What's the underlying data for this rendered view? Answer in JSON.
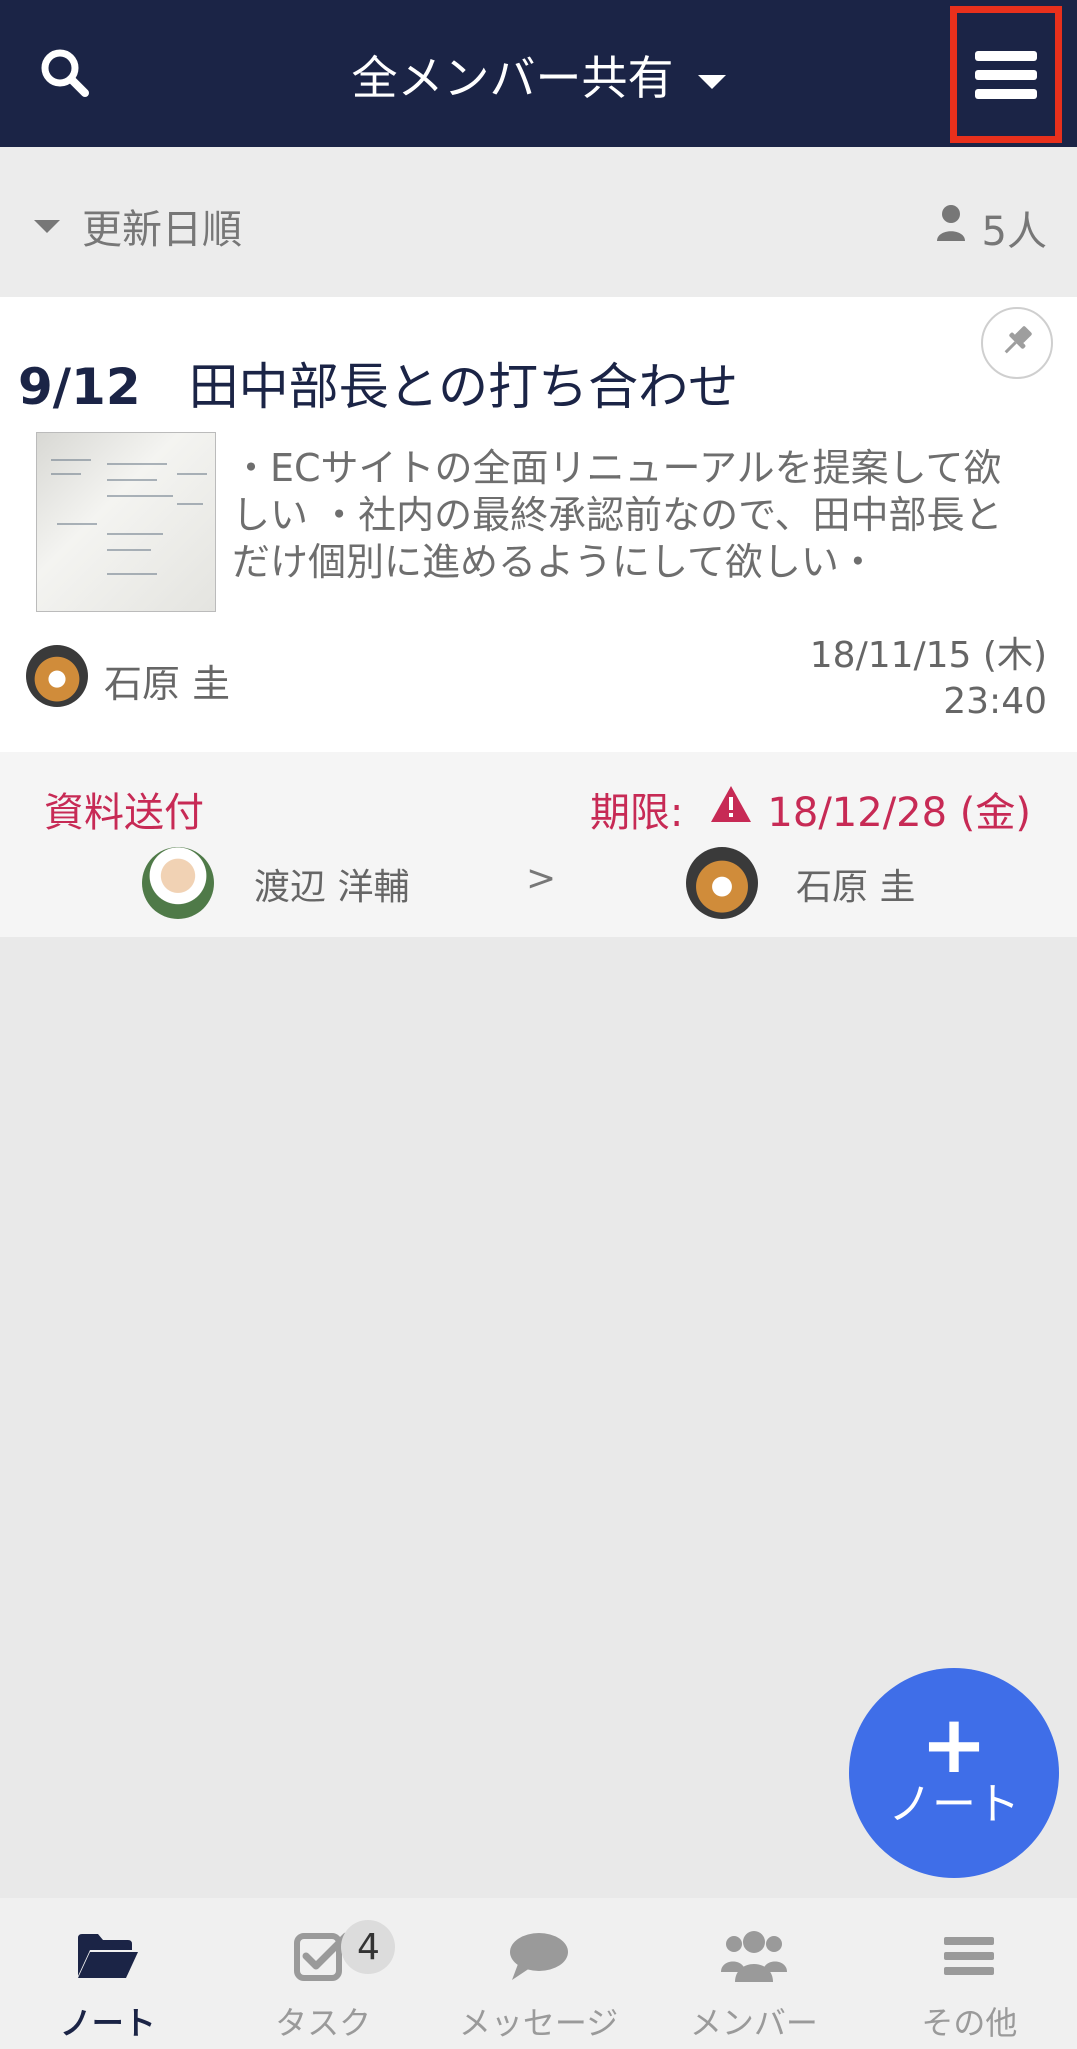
{
  "header": {
    "title": "全メンバー共有",
    "search_icon": "search-icon",
    "menu_icon": "hamburger-menu-icon",
    "highlight_color": "#e8301c",
    "bg_color": "#1b2446"
  },
  "sort": {
    "label": "更新日順",
    "members": "5人"
  },
  "note": {
    "date": "9/12",
    "title": "田中部長との打ち合わせ",
    "preview": "・ECサイトの全面リニューアルを提案して欲しい ・社内の最終承認前なので、田中部長とだけ個別に進めるようにして欲しい・",
    "author": "石原 圭",
    "updated_date": "18/11/15 (木)",
    "updated_time": "23:40",
    "pin_icon": "pin-icon"
  },
  "task": {
    "title": "資料送付",
    "deadline_label": "期限:",
    "deadline_date": "18/12/28 (金)",
    "from": "渡辺 洋輔",
    "arrow": ">",
    "to": "石原 圭",
    "accent_color": "#c72a55"
  },
  "fab": {
    "plus": "+",
    "label": "ノート",
    "color": "#3f6ee8"
  },
  "tabs": [
    {
      "label": "ノート",
      "icon": "folder-open-icon",
      "active": true
    },
    {
      "label": "タスク",
      "icon": "checkbox-icon",
      "badge": "4"
    },
    {
      "label": "メッセージ",
      "icon": "chat-bubble-icon"
    },
    {
      "label": "メンバー",
      "icon": "users-icon"
    },
    {
      "label": "その他",
      "icon": "menu-icon"
    }
  ]
}
